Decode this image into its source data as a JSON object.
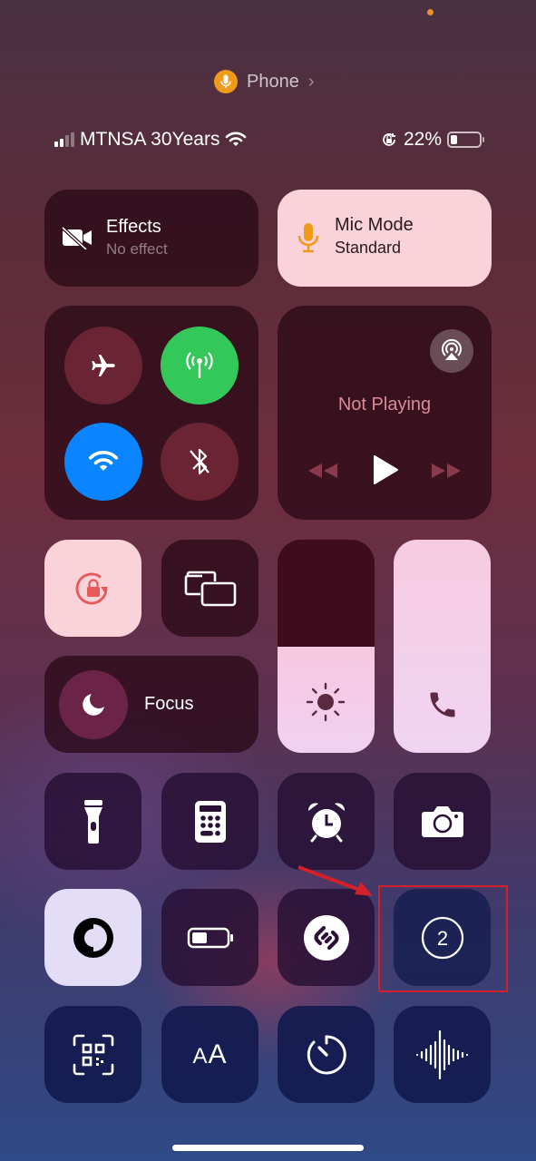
{
  "indicator_dot_color": "#e8902c",
  "now_playing_source": {
    "icon": "mic-icon",
    "label": "Phone",
    "chevron": "›"
  },
  "status_bar": {
    "carrier": "MTNSA 30Years",
    "signal_bars_active": 2,
    "signal_bars_total": 4,
    "wifi_icon": "wifi-icon",
    "orientation_lock_icon": "orientation-lock-icon",
    "battery_percent_text": "22%",
    "battery_level": 0.22
  },
  "effects": {
    "title": "Effects",
    "subtitle": "No effect",
    "icon": "video-slash-icon"
  },
  "mic_mode": {
    "title": "Mic Mode",
    "subtitle": "Standard",
    "icon": "mic-icon",
    "accent": "#f09a1a"
  },
  "connectivity": {
    "airplane": {
      "icon": "airplane-icon",
      "active": false
    },
    "cellular": {
      "icon": "cellular-antenna-icon",
      "active": true,
      "color": "#34c759"
    },
    "wifi": {
      "icon": "wifi-icon",
      "active": true,
      "color": "#0a84ff"
    },
    "bluetooth": {
      "icon": "bluetooth-off-icon",
      "active": false
    }
  },
  "media": {
    "status": "Not Playing",
    "airplay_icon": "airplay-audio-icon",
    "controls": [
      "rewind-icon",
      "play-icon",
      "fast-forward-icon"
    ]
  },
  "orientation_lock": {
    "icon": "orientation-lock-icon",
    "active": true,
    "color": "#e85a5a"
  },
  "screen_mirroring": {
    "icon": "screen-mirroring-icon"
  },
  "focus": {
    "label": "Focus",
    "icon": "moon-icon"
  },
  "brightness": {
    "icon": "sun-icon",
    "level": 0.5
  },
  "call_volume": {
    "icon": "phone-icon",
    "level": 1.0
  },
  "row_controls_1": [
    {
      "name": "flashlight",
      "icon": "flashlight-icon"
    },
    {
      "name": "calculator",
      "icon": "calculator-icon"
    },
    {
      "name": "alarm",
      "icon": "alarm-clock-icon"
    },
    {
      "name": "camera",
      "icon": "camera-icon"
    }
  ],
  "row_controls_2": [
    {
      "name": "dark-mode",
      "icon": "dark-mode-icon"
    },
    {
      "name": "low-power",
      "icon": "battery-icon"
    },
    {
      "name": "shazam",
      "icon": "shazam-icon"
    },
    {
      "name": "screen-recording",
      "icon": "record-countdown-icon",
      "badge": "2"
    }
  ],
  "row_controls_3": [
    {
      "name": "code-scanner",
      "icon": "qr-code-scanner-icon"
    },
    {
      "name": "text-size",
      "icon": "text-size-icon",
      "label": "AA"
    },
    {
      "name": "timer",
      "icon": "timer-icon"
    },
    {
      "name": "voice-memo",
      "icon": "waveform-icon"
    }
  ],
  "annotation": {
    "color": "#d4202a",
    "target": "screen-recording"
  }
}
